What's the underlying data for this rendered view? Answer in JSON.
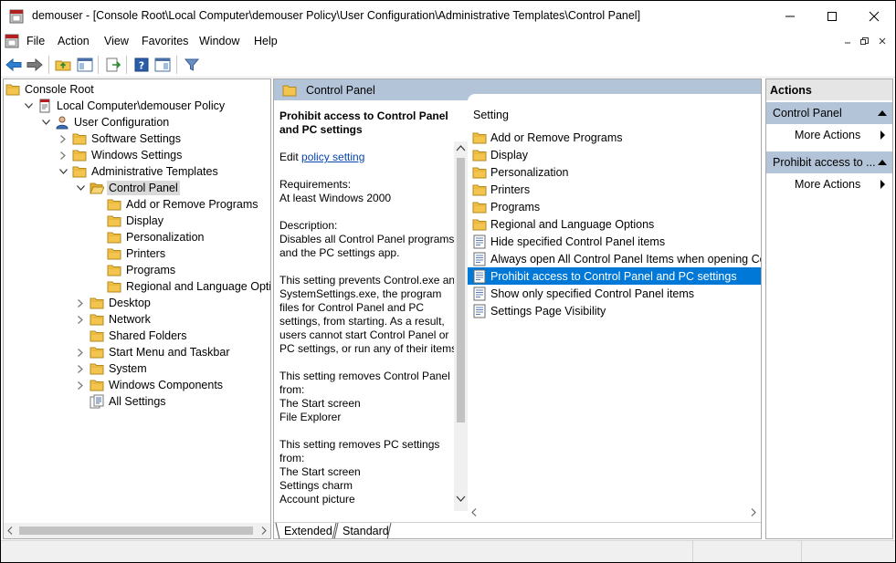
{
  "window": {
    "title": "demouser - [Console Root\\Local Computer\\demouser Policy\\User Configuration\\Administrative Templates\\Control Panel]"
  },
  "menu": {
    "items": [
      "File",
      "Action",
      "View",
      "Favorites",
      "Window",
      "Help"
    ]
  },
  "tree": {
    "items": [
      {
        "label": "Console Root",
        "icon": "folder-icon"
      },
      {
        "label": "Local Computer\\demouser Policy",
        "icon": "policy-document-icon"
      },
      {
        "label": "User Configuration",
        "icon": "user-icon"
      },
      {
        "label": "Software Settings",
        "icon": "folder-icon"
      },
      {
        "label": "Windows Settings",
        "icon": "folder-icon"
      },
      {
        "label": "Administrative Templates",
        "icon": "folder-icon"
      },
      {
        "label": "Control Panel",
        "icon": "folder-open-icon"
      },
      {
        "label": "Add or Remove Programs",
        "icon": "folder-icon"
      },
      {
        "label": "Display",
        "icon": "folder-icon"
      },
      {
        "label": "Personalization",
        "icon": "folder-icon"
      },
      {
        "label": "Printers",
        "icon": "folder-icon"
      },
      {
        "label": "Programs",
        "icon": "folder-icon"
      },
      {
        "label": "Regional and Language Options",
        "icon": "folder-icon"
      },
      {
        "label": "Desktop",
        "icon": "folder-icon"
      },
      {
        "label": "Network",
        "icon": "folder-icon"
      },
      {
        "label": "Shared Folders",
        "icon": "folder-icon"
      },
      {
        "label": "Start Menu and Taskbar",
        "icon": "folder-icon"
      },
      {
        "label": "System",
        "icon": "folder-icon"
      },
      {
        "label": "Windows Components",
        "icon": "folder-icon"
      },
      {
        "label": "All Settings",
        "icon": "all-settings-icon"
      }
    ]
  },
  "middle": {
    "header": "Control Panel",
    "description": {
      "title": "Prohibit access to Control Panel and PC settings",
      "edit_prefix": "Edit ",
      "edit_link": "policy setting",
      "requirements_label": "Requirements:",
      "requirements_value": "At least Windows 2000",
      "description_label": "Description:",
      "description_text": "Disables all Control Panel programs and the PC settings app.",
      "para2": "This setting prevents Control.exe and SystemSettings.exe, the program files for Control Panel and PC settings, from starting. As a result, users cannot start Control Panel or PC settings, or run any of their items.",
      "para3_label": "This setting removes Control Panel from:",
      "para3_items": [
        "The Start screen",
        "File Explorer"
      ],
      "para4_label": "This setting removes PC settings from:",
      "para4_items": [
        "The Start screen",
        "Settings charm",
        "Account picture"
      ]
    },
    "list": {
      "column_header": "Setting",
      "rows": [
        {
          "label": "Add or Remove Programs",
          "icon": "folder-icon"
        },
        {
          "label": "Display",
          "icon": "folder-icon"
        },
        {
          "label": "Personalization",
          "icon": "folder-icon"
        },
        {
          "label": "Printers",
          "icon": "folder-icon"
        },
        {
          "label": "Programs",
          "icon": "folder-icon"
        },
        {
          "label": "Regional and Language Options",
          "icon": "folder-icon"
        },
        {
          "label": "Hide specified Control Panel items",
          "icon": "setting-page-icon"
        },
        {
          "label": "Always open All Control Panel Items when opening Cont",
          "icon": "setting-page-icon"
        },
        {
          "label": "Prohibit access to Control Panel and PC settings",
          "icon": "setting-page-icon"
        },
        {
          "label": "Show only specified Control Panel items",
          "icon": "setting-page-icon"
        },
        {
          "label": "Settings Page Visibility",
          "icon": "setting-page-icon"
        }
      ]
    },
    "tabs": [
      "Extended",
      "Standard"
    ]
  },
  "actions": {
    "header": "Actions",
    "groups": [
      {
        "label": "Control Panel",
        "item": "More Actions"
      },
      {
        "label": "Prohibit access to ...",
        "item": "More Actions"
      }
    ]
  },
  "colors": {
    "selection": "#0078d7",
    "header_band": "#b3c4d8",
    "folder": "#f3c44e",
    "link": "#0645ad"
  }
}
